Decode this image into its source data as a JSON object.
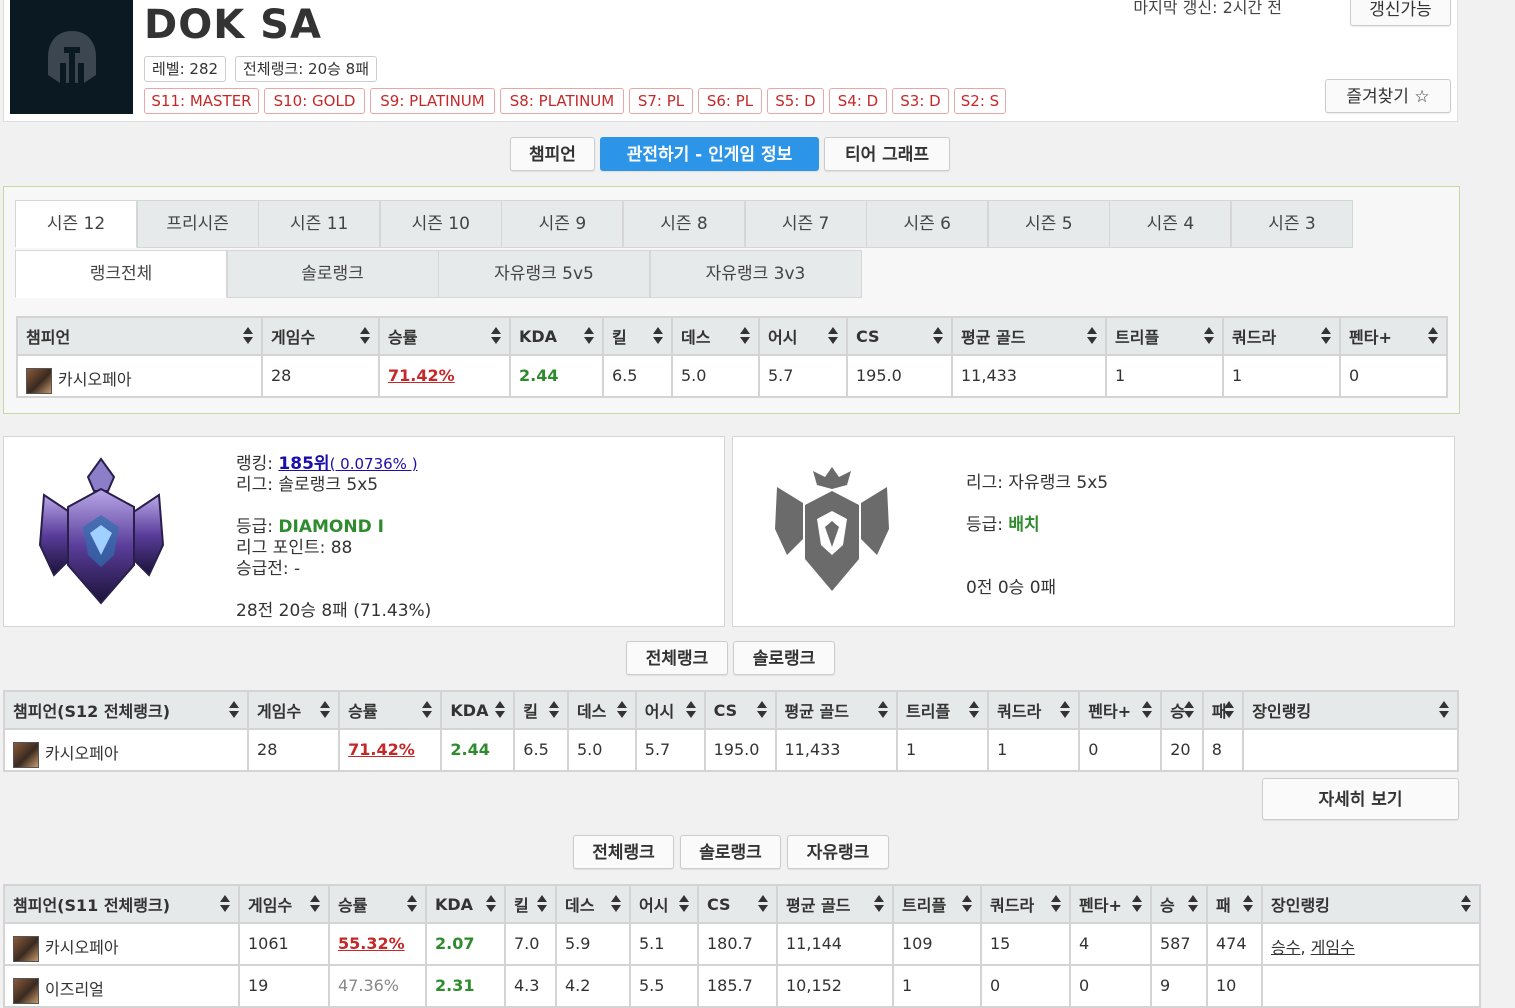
{
  "profile": {
    "name": "DOK SA",
    "level": "레벨: 282",
    "overall_rank": "전체랭크: 20승 8패",
    "last_update": "마지막 갱신: 2시간 전",
    "refresh_label": "갱신가능",
    "favorite_label": "즐겨찾기 ☆",
    "season_badges": [
      "S11: MASTER",
      "S10: GOLD",
      "S9: PLATINUM",
      "S8: PLATINUM",
      "S7: PL",
      "S6: PL",
      "S5: D",
      "S4: D",
      "S3: D",
      "S2: S"
    ]
  },
  "main_nav": {
    "champion": "챔피언",
    "spectate": "관전하기 - 인게임 정보",
    "tier_graph": "티어 그래프",
    "active": "spectate"
  },
  "season_tabs": [
    "시즌 12",
    "프리시즌",
    "시즌 11",
    "시즌 10",
    "시즌 9",
    "시즌 8",
    "시즌 7",
    "시즌 6",
    "시즌 5",
    "시즌 4",
    "시즌 3"
  ],
  "queue_tabs": [
    "랭크전체",
    "솔로랭크",
    "자유랭크 5v5",
    "자유랭크 3v3"
  ],
  "season_table": {
    "headers": [
      "챔피언",
      "게임수",
      "승률",
      "KDA",
      "킬",
      "데스",
      "어시",
      "CS",
      "평균 골드",
      "트리플",
      "쿼드라",
      "펜타+"
    ],
    "rows": [
      {
        "champion": "카시오페아",
        "games": "28",
        "winrate": "71.42%",
        "kda": "2.44",
        "kills": "6.5",
        "deaths": "5.0",
        "assists": "5.7",
        "cs": "195.0",
        "gold": "11,433",
        "triple": "1",
        "quadra": "1",
        "penta": "0"
      }
    ]
  },
  "solo_rank": {
    "ranking_label": "랭킹:",
    "ranking": "185위",
    "ranking_pct": "( 0.0736% )",
    "league": "리그: 솔로랭크 5x5",
    "tier_label": "등급:",
    "tier": "DIAMOND I",
    "lp": "리그 포인트: 88",
    "promo": "승급전: -",
    "record": "28전 20승 8패 (71.43%)"
  },
  "flex_rank": {
    "league": "리그: 자유랭크 5x5",
    "tier_label": "등급:",
    "tier": "배치",
    "record": "0전 0승 0패"
  },
  "s12_toggle": {
    "all": "전체랭크",
    "solo": "솔로랭크"
  },
  "s12_table": {
    "headers": [
      "챔피언(S12 전체랭크)",
      "게임수",
      "승률",
      "KDA",
      "킬",
      "데스",
      "어시",
      "CS",
      "평균 골드",
      "트리플",
      "쿼드라",
      "펜타+",
      "승",
      "패",
      "장인랭킹"
    ],
    "rows": [
      {
        "champion": "카시오페아",
        "games": "28",
        "winrate": "71.42%",
        "kda": "2.44",
        "kills": "6.5",
        "deaths": "5.0",
        "assists": "5.7",
        "cs": "195.0",
        "gold": "11,433",
        "triple": "1",
        "quadra": "1",
        "penta": "0",
        "wins": "20",
        "losses": "8",
        "mastery": ""
      }
    ]
  },
  "details_button": "자세히 보기",
  "s11_toggle": {
    "all": "전체랭크",
    "solo": "솔로랭크",
    "flex": "자유랭크"
  },
  "s11_table": {
    "headers": [
      "챔피언(S11 전체랭크)",
      "게임수",
      "승률",
      "KDA",
      "킬",
      "데스",
      "어시",
      "CS",
      "평균 골드",
      "트리플",
      "쿼드라",
      "펜타+",
      "승",
      "패",
      "장인랭킹"
    ],
    "rows": [
      {
        "champion": "카시오페아",
        "games": "1061",
        "winrate": "55.32%",
        "kda": "2.07",
        "kills": "7.0",
        "deaths": "5.9",
        "assists": "5.1",
        "cs": "180.7",
        "gold": "11,144",
        "triple": "109",
        "quadra": "15",
        "penta": "4",
        "wins": "587",
        "losses": "474",
        "mastery_win": "승수",
        "mastery_games": "게임수"
      },
      {
        "champion": "이즈리얼",
        "games": "19",
        "winrate": "47.36%",
        "kda": "2.31",
        "kills": "4.3",
        "deaths": "4.2",
        "assists": "5.5",
        "cs": "185.7",
        "gold": "10,152",
        "triple": "1",
        "quadra": "0",
        "penta": "0",
        "wins": "9",
        "losses": "10"
      }
    ]
  },
  "colors": {
    "accent_blue": "#2d95e8",
    "winrate_red": "#c62828",
    "kda_green": "#2e8b2e",
    "badge_red": "#c62828"
  }
}
